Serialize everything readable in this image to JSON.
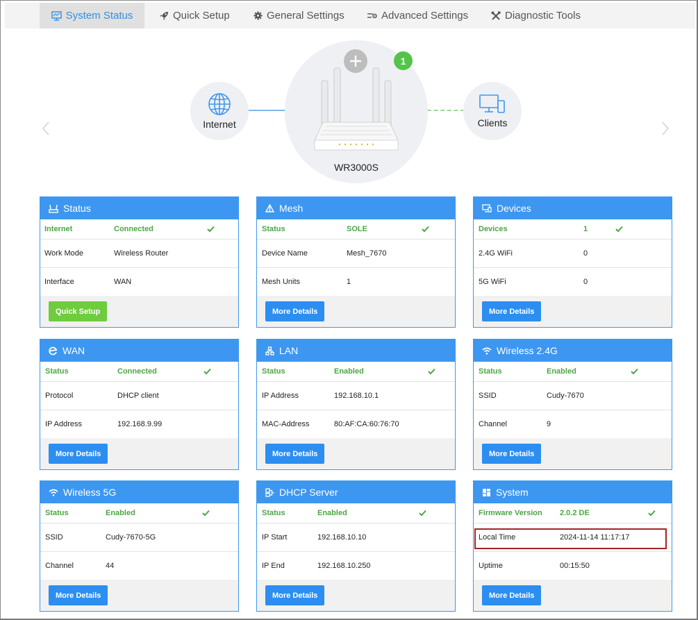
{
  "nav": {
    "tabs": [
      {
        "label": "System Status",
        "icon": "monitor-icon",
        "active": true
      },
      {
        "label": "Quick Setup",
        "icon": "rocket-icon",
        "active": false
      },
      {
        "label": "General Settings",
        "icon": "gear-icon",
        "active": false
      },
      {
        "label": "Advanced Settings",
        "icon": "advanced-settings-icon",
        "active": false
      },
      {
        "label": "Diagnostic Tools",
        "icon": "tools-icon",
        "active": false
      }
    ]
  },
  "topology": {
    "internet_label": "Internet",
    "clients_label": "Clients",
    "router_name": "WR3000S",
    "mesh_badge": "1"
  },
  "cards": {
    "status": {
      "title": "Status",
      "rows": [
        {
          "label": "Internet",
          "value": "Connected"
        },
        {
          "label": "Work Mode",
          "value": "Wireless Router"
        },
        {
          "label": "Interface",
          "value": "WAN"
        }
      ],
      "button": "Quick Setup"
    },
    "mesh": {
      "title": "Mesh",
      "rows": [
        {
          "label": "Status",
          "value": "SOLE"
        },
        {
          "label": "Device Name",
          "value": "Mesh_7670"
        },
        {
          "label": "Mesh Units",
          "value": "1"
        }
      ],
      "button": "More Details"
    },
    "devices": {
      "title": "Devices",
      "rows": [
        {
          "label": "Devices",
          "value": "1"
        },
        {
          "label": "2.4G WiFi",
          "value": "0"
        },
        {
          "label": "5G WiFi",
          "value": "0"
        }
      ],
      "button": "More Details"
    },
    "wan": {
      "title": "WAN",
      "rows": [
        {
          "label": "Status",
          "value": "Connected"
        },
        {
          "label": "Protocol",
          "value": "DHCP client"
        },
        {
          "label": "IP Address",
          "value": "192.168.9.99"
        }
      ],
      "button": "More Details"
    },
    "lan": {
      "title": "LAN",
      "rows": [
        {
          "label": "Status",
          "value": "Enabled"
        },
        {
          "label": "IP Address",
          "value": "192.168.10.1"
        },
        {
          "label": "MAC-Address",
          "value": "80:AF:CA:60:76:70"
        }
      ],
      "button": "More Details"
    },
    "wireless24": {
      "title": "Wireless 2.4G",
      "rows": [
        {
          "label": "Status",
          "value": "Enabled"
        },
        {
          "label": "SSID",
          "value": "Cudy-7670"
        },
        {
          "label": "Channel",
          "value": "9"
        }
      ],
      "button": "More Details"
    },
    "wireless5": {
      "title": "Wireless 5G",
      "rows": [
        {
          "label": "Status",
          "value": "Enabled"
        },
        {
          "label": "SSID",
          "value": "Cudy-7670-5G"
        },
        {
          "label": "Channel",
          "value": "44"
        }
      ],
      "button": "More Details"
    },
    "dhcp": {
      "title": "DHCP Server",
      "rows": [
        {
          "label": "Status",
          "value": "Enabled"
        },
        {
          "label": "IP Start",
          "value": "192.168.10.10"
        },
        {
          "label": "IP End",
          "value": "192.168.10.250"
        }
      ],
      "button": "More Details"
    },
    "system": {
      "title": "System",
      "rows": [
        {
          "label": "Firmware Version",
          "value": "2.0.2 DE"
        },
        {
          "label": "Local Time",
          "value": "2024-11-14 11:17:17"
        },
        {
          "label": "Uptime",
          "value": "00:15:50"
        }
      ],
      "button": "More Details"
    }
  },
  "colors": {
    "accent": "#3d97f0",
    "ok_green": "#4ca644",
    "quick_setup_green": "#6fcc3e",
    "highlight_red": "#a52325"
  }
}
